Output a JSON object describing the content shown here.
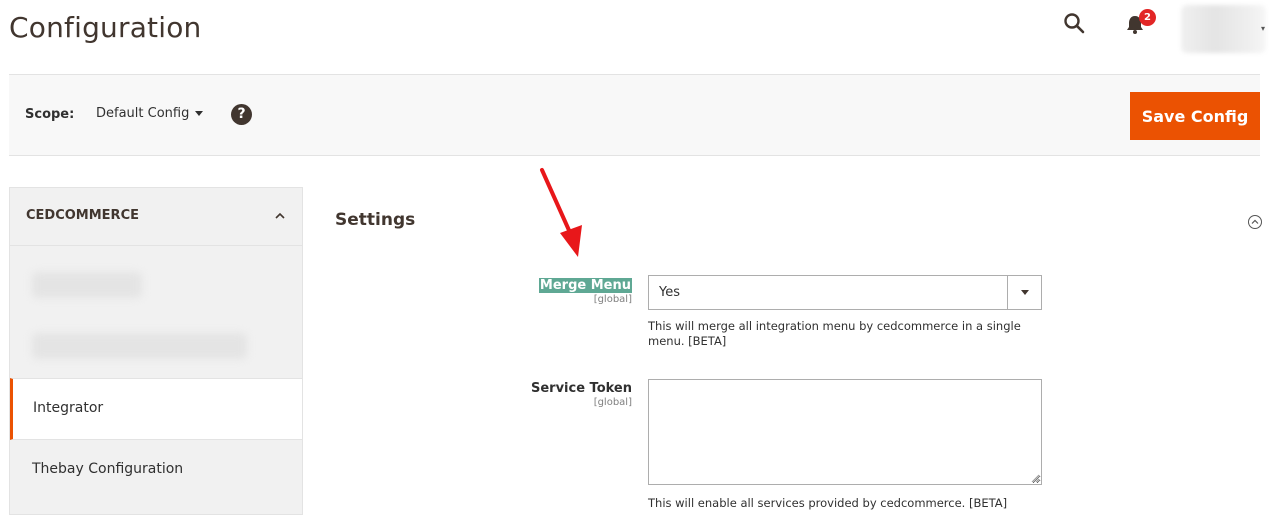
{
  "header": {
    "title": "Configuration",
    "notification_count": "2"
  },
  "scope_bar": {
    "label": "Scope:",
    "value": "Default Config",
    "save_label": "Save Config"
  },
  "sidebar": {
    "section_title": "CEDCOMMERCE",
    "items": [
      {
        "label": "Integrator",
        "active": true
      },
      {
        "label": "Thebay Configuration",
        "active": false
      }
    ]
  },
  "group": {
    "title": "Settings"
  },
  "fields": {
    "merge_menu": {
      "label": "Merge Menu",
      "scope": "[global]",
      "value": "Yes",
      "note": "This will merge all integration menu by cedcommerce in a single menu. [BETA]"
    },
    "service_token": {
      "label": "Service Token",
      "scope": "[global]",
      "value": "",
      "note": "This will enable all services provided by cedcommerce. [BETA]"
    }
  },
  "colors": {
    "accent": "#eb5202",
    "highlight": "#5fa894",
    "annotation_arrow": "#e8171a",
    "badge": "#e22626"
  }
}
